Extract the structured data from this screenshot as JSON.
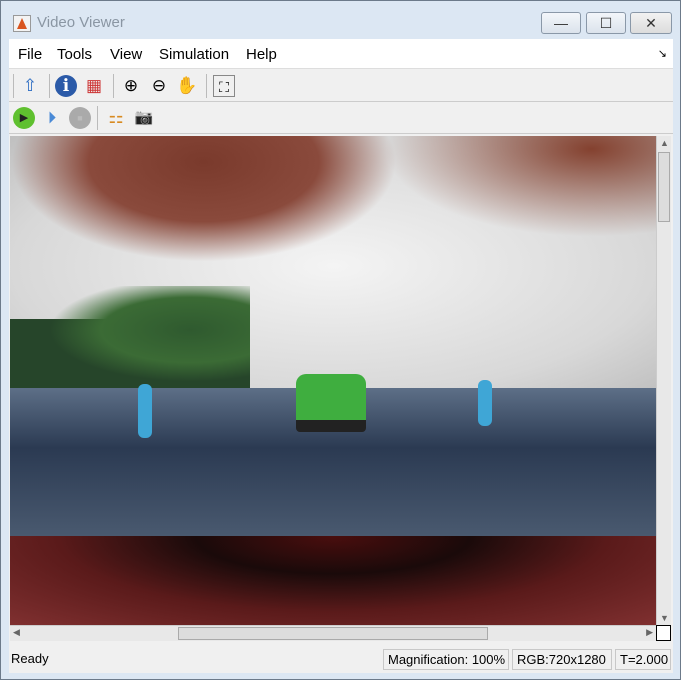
{
  "window": {
    "title": "Video Viewer",
    "minimize": "—",
    "maximize": "☐",
    "close": "✕"
  },
  "menu": [
    "File",
    "Tools",
    "View",
    "Simulation",
    "Help"
  ],
  "menu_dock": "↘",
  "toolbar1": [
    {
      "icon": "open-in-simulink-icon",
      "glyph": "⇧"
    },
    {
      "icon": "info-icon",
      "glyph": "ℹ"
    },
    {
      "icon": "colormap-icon",
      "glyph": "▦"
    },
    {
      "icon": "zoom-in-icon",
      "glyph": "⊕"
    },
    {
      "icon": "zoom-out-icon",
      "glyph": "⊖"
    },
    {
      "icon": "pan-hand-icon",
      "glyph": "✋"
    },
    {
      "icon": "fit-to-view-icon",
      "glyph": "⛶"
    }
  ],
  "toolbar2": [
    {
      "icon": "play-icon",
      "glyph": "▶"
    },
    {
      "icon": "step-forward-icon",
      "glyph": "⏵"
    },
    {
      "icon": "stop-icon",
      "glyph": "■"
    },
    {
      "icon": "highlight-block-icon",
      "glyph": "⚏"
    },
    {
      "icon": "snapshot-camera-icon",
      "glyph": "📷"
    }
  ],
  "status": {
    "state": "Ready",
    "magnification": "Magnification: 100%",
    "format": "RGB:720x1280",
    "time": "T=2.000"
  }
}
